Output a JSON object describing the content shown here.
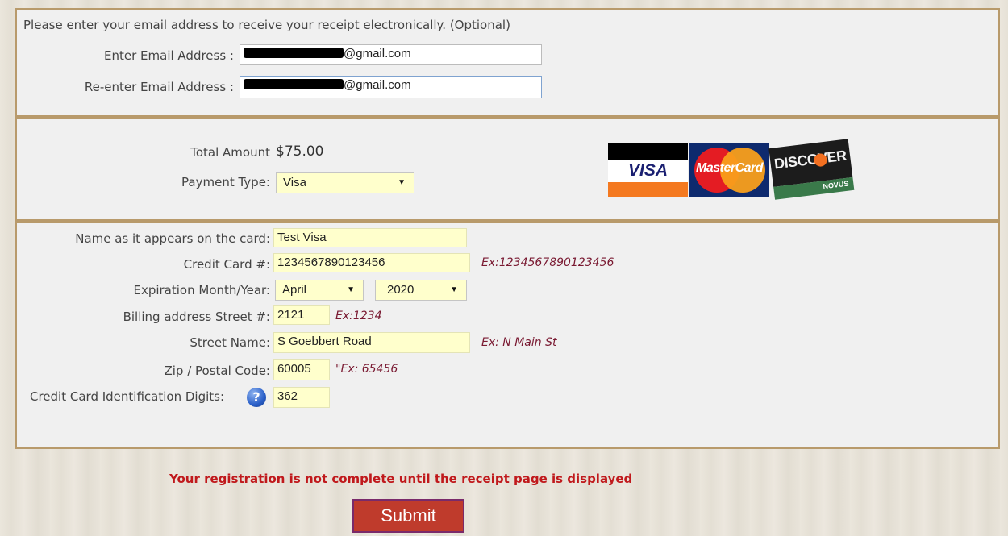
{
  "email_section": {
    "prompt": "Please enter your email address to receive your receipt electronically. (Optional)",
    "email_label": "Enter Email Address :",
    "email_value_suffix": "@gmail.com",
    "reenter_label": "Re-enter Email Address :",
    "reenter_value_suffix": "@gmail.com"
  },
  "payment_section": {
    "total_label": "Total Amount",
    "total_value": "$75.00",
    "type_label": "Payment Type:",
    "type_value": "Visa",
    "cards": [
      "VISA",
      "MasterCard",
      "DISCOVER",
      "NOVUS"
    ]
  },
  "card_section": {
    "name_label": "Name as it appears on the card:",
    "name_value": "Test Visa",
    "number_label": "Credit Card #:",
    "number_value": "1234567890123456",
    "number_hint": "Ex:1234567890123456",
    "expiration_label": "Expiration Month/Year:",
    "month_value": "April",
    "year_value": "2020",
    "street_no_label": "Billing address Street #:",
    "street_no_value": "2121",
    "street_no_hint": "Ex:1234",
    "street_name_label": "Street Name:",
    "street_name_value": "S Goebbert Road",
    "street_name_hint": "Ex: N Main St",
    "zip_label": "Zip / Postal Code:",
    "zip_value": "60005",
    "zip_hint": "\"Ex: 65456",
    "cvv_label": "Credit Card Identification Digits:",
    "cvv_value": "362",
    "help_glyph": "?"
  },
  "footer": {
    "warning": "Your registration is not complete until the receipt page is displayed",
    "submit_label": "Submit"
  },
  "colors": {
    "panel_border": "#b89a6b",
    "hint": "#7a1a32",
    "warning": "#c0191c",
    "submit_bg": "#bf3b2c"
  }
}
